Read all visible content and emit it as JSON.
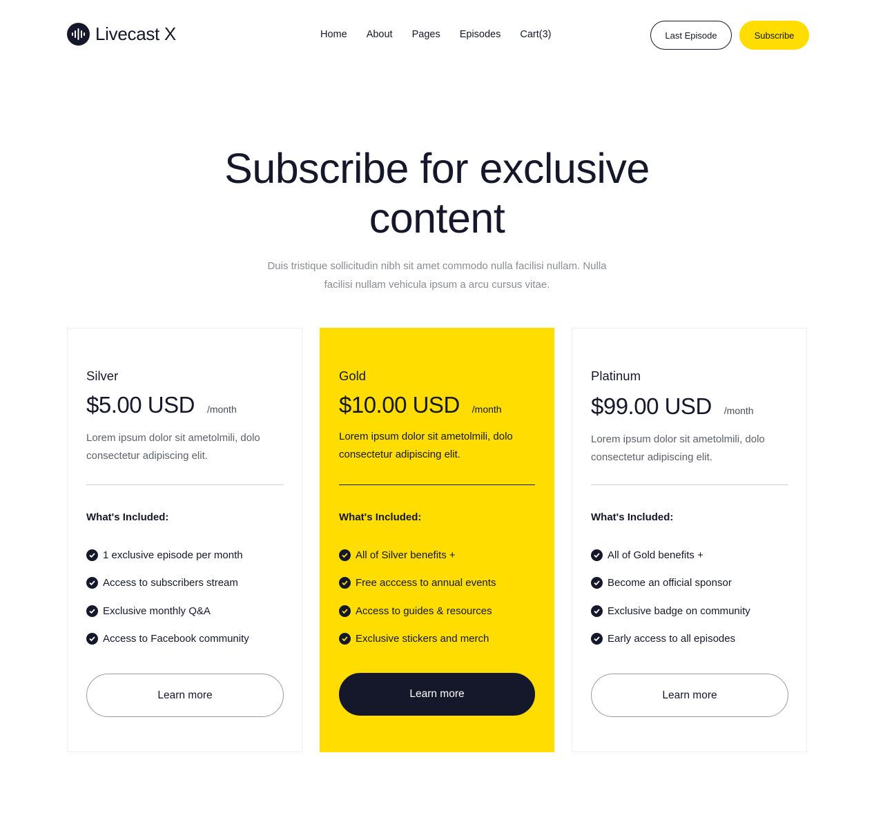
{
  "brand": {
    "name": "Livecast X",
    "accent": "#ffdd00",
    "dark": "#15172a"
  },
  "nav": {
    "home": "Home",
    "about": "About",
    "pages": "Pages",
    "episodes": "Episodes",
    "cart": "Cart(3)"
  },
  "header_buttons": {
    "last_episode": "Last Episode",
    "subscribe": "Subscribe"
  },
  "hero": {
    "title": "Subscribe for exclusive content",
    "subtitle": "Duis tristique sollicitudin nibh sit amet commodo nulla facilisi nullam. Nulla facilisi nullam vehicula ipsum a arcu cursus vitae."
  },
  "plans": [
    {
      "tier": "Silver",
      "price": "$5.00 USD",
      "period": "/month",
      "description": "Lorem ipsum dolor sit ametolmili, dolo consectetur adipiscing elit.",
      "included_title": "What's Included:",
      "features": [
        "1 exclusive episode per month",
        "Access to subscribers stream",
        "Exclusive monthly Q&A",
        "Access to Facebook community"
      ],
      "cta": "Learn more"
    },
    {
      "tier": "Gold",
      "price": "$10.00 USD",
      "period": "/month",
      "description": "Lorem ipsum dolor sit ametolmili, dolo consectetur adipiscing elit.",
      "included_title": "What's Included:",
      "features": [
        "All of Silver benefits +",
        "Free acccess to annual events",
        "Access to guides & resources",
        "Exclusive stickers and merch"
      ],
      "cta": "Learn more"
    },
    {
      "tier": "Platinum",
      "price": "$99.00 USD",
      "period": "/month",
      "description": "Lorem ipsum dolor sit ametolmili, dolo consectetur adipiscing elit.",
      "included_title": "What's Included:",
      "features": [
        "All of Gold benefits +",
        "Become an official sponsor",
        "Exclusive badge on community",
        "Early access to all episodes"
      ],
      "cta": "Learn more"
    }
  ]
}
